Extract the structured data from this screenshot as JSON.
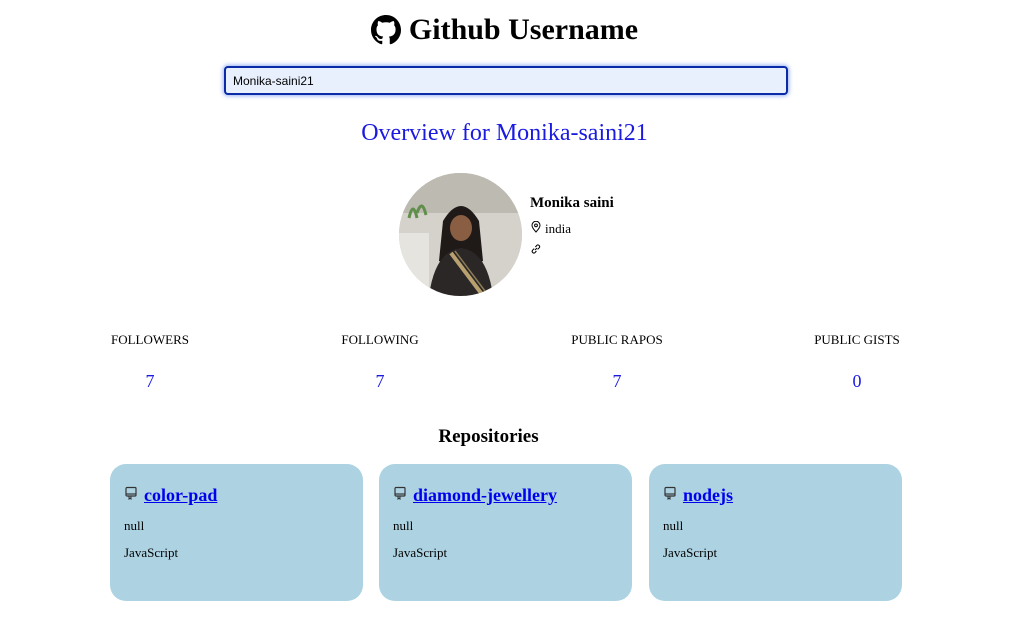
{
  "header": {
    "title": "Github Username",
    "icon": "github-icon"
  },
  "search": {
    "value": "Monika-saini21",
    "placeholder": ""
  },
  "overview": {
    "text": "Overview for Monika-saini21"
  },
  "profile": {
    "name": "Monika saini",
    "location": "india",
    "location_icon": "location-pin-icon",
    "link_icon": "link-icon"
  },
  "stats": [
    {
      "label": "FOLLOWERS",
      "value": "7"
    },
    {
      "label": "FOLLOWING",
      "value": "7"
    },
    {
      "label": "PUBLIC RAPOS",
      "value": "7"
    },
    {
      "label": "PUBLIC GISTS",
      "value": "0"
    }
  ],
  "repositories": {
    "title": "Repositories",
    "items": [
      {
        "name": "color-pad",
        "description": "null",
        "language": "JavaScript"
      },
      {
        "name": "diamond-jewellery",
        "description": "null",
        "language": "JavaScript"
      },
      {
        "name": "nodejs",
        "description": "null",
        "language": "JavaScript"
      }
    ]
  },
  "colors": {
    "accent": "#1a1ae0",
    "link": "#0000ee",
    "card_bg": "#add3e3",
    "input_border": "#0a2aa8"
  }
}
